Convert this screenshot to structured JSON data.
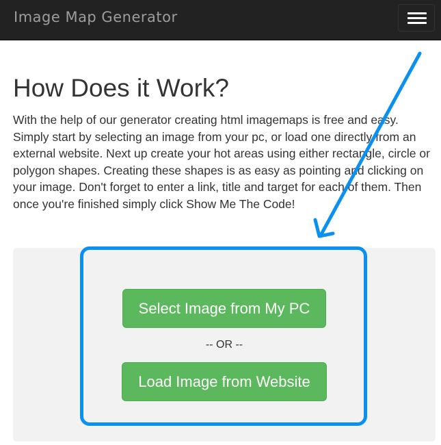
{
  "navbar": {
    "brand": "Image Map Generator",
    "menu_icon": "hamburger-menu-icon"
  },
  "main": {
    "heading": "How Does it Work?",
    "intro": "With the help of our generator creating html imagemaps is free and easy. Simply start by selecting an image from your pc, or load one directly from an external website. Next up create your hot areas using either rectangle, circle or polygon shapes. Creating these shapes is as easy as pointing and clicking on your image. Don't forget to enter a link, title and target for each of them. Then once you're finished simply click Show Me The Code!"
  },
  "upload": {
    "select_pc_label": "Select Image from My PC",
    "or_label": "-- OR --",
    "load_website_label": "Load Image from Website"
  },
  "colors": {
    "navbar_bg": "#222222",
    "button_green": "#5cb85c",
    "annotation_blue": "#0a90f0",
    "panel_bg": "#f2f2f2"
  }
}
